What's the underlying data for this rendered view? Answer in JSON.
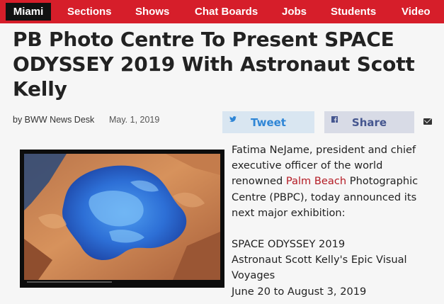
{
  "nav": {
    "city": "Miami",
    "items": [
      "Sections",
      "Shows",
      "Chat Boards",
      "Jobs",
      "Students",
      "Video"
    ]
  },
  "article": {
    "headline": "PB Photo Centre To Present SPACE ODYSSEY 2019 With Astronaut Scott Kelly",
    "byline": "by BWW News Desk",
    "date": "May. 1, 2019",
    "share": {
      "tweet_label": "Tweet",
      "tweet_icon": "twitter-icon",
      "share_label": "Share",
      "share_icon": "facebook-icon",
      "email_icon": "email-icon"
    },
    "image_alt": "Satellite photograph of a lake surrounded by desert terrain",
    "para1_line1": "Fatima NeJame, president and chief",
    "para1_line2": "executive officer of the world",
    "para1_line3_pre": "renowned ",
    "para1_link": "Palm Beach",
    "para1_line3_post": " Photographic",
    "para1_line4": "Centre (PBPC), today announced its",
    "para1_line5": "next major exhibition:",
    "para2_line1": "SPACE ODYSSEY 2019",
    "para2_line2": "Astronaut Scott Kelly's Epic Visual",
    "para2_line3": "Voyages",
    "para2_line4": "June 20 to August 3, 2019"
  },
  "colors": {
    "nav_bg": "#d61e2a",
    "link": "#b41b24",
    "tweet": "#2f86d6",
    "facebook": "#45568f"
  }
}
